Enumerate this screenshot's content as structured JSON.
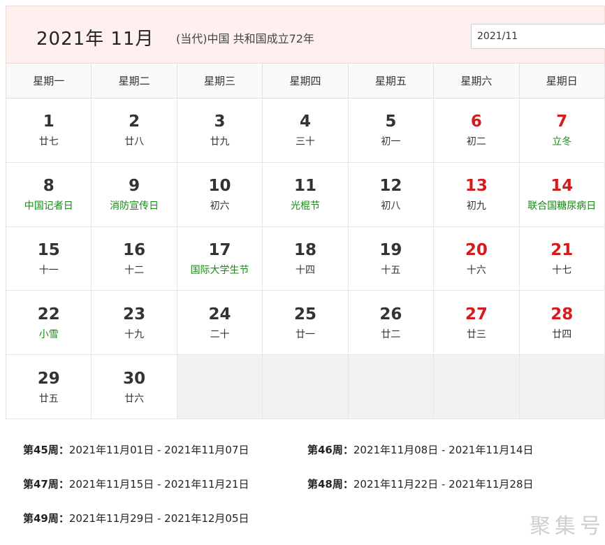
{
  "header": {
    "title": "2021年  11月",
    "era": "(当代)中国 共和国成立72年",
    "date_input_value": "2021/11"
  },
  "weekdays": [
    "星期一",
    "星期二",
    "星期三",
    "星期四",
    "星期五",
    "星期六",
    "星期日"
  ],
  "days": [
    {
      "day": "1",
      "sub": "廿七",
      "red": false,
      "green": false
    },
    {
      "day": "2",
      "sub": "廿八",
      "red": false,
      "green": false
    },
    {
      "day": "3",
      "sub": "廿九",
      "red": false,
      "green": false
    },
    {
      "day": "4",
      "sub": "三十",
      "red": false,
      "green": false
    },
    {
      "day": "5",
      "sub": "初一",
      "red": false,
      "green": false
    },
    {
      "day": "6",
      "sub": "初二",
      "red": true,
      "green": false
    },
    {
      "day": "7",
      "sub": "立冬",
      "red": true,
      "green": true
    },
    {
      "day": "8",
      "sub": "中国记者日",
      "red": false,
      "green": true
    },
    {
      "day": "9",
      "sub": "消防宣传日",
      "red": false,
      "green": true
    },
    {
      "day": "10",
      "sub": "初六",
      "red": false,
      "green": false
    },
    {
      "day": "11",
      "sub": "光棍节",
      "red": false,
      "green": true
    },
    {
      "day": "12",
      "sub": "初八",
      "red": false,
      "green": false
    },
    {
      "day": "13",
      "sub": "初九",
      "red": true,
      "green": false
    },
    {
      "day": "14",
      "sub": "联合国糖尿病日",
      "red": true,
      "green": true
    },
    {
      "day": "15",
      "sub": "十一",
      "red": false,
      "green": false
    },
    {
      "day": "16",
      "sub": "十二",
      "red": false,
      "green": false
    },
    {
      "day": "17",
      "sub": "国际大学生节",
      "red": false,
      "green": true
    },
    {
      "day": "18",
      "sub": "十四",
      "red": false,
      "green": false
    },
    {
      "day": "19",
      "sub": "十五",
      "red": false,
      "green": false
    },
    {
      "day": "20",
      "sub": "十六",
      "red": true,
      "green": false
    },
    {
      "day": "21",
      "sub": "十七",
      "red": true,
      "green": false
    },
    {
      "day": "22",
      "sub": "小雪",
      "red": false,
      "green": true
    },
    {
      "day": "23",
      "sub": "十九",
      "red": false,
      "green": false
    },
    {
      "day": "24",
      "sub": "二十",
      "red": false,
      "green": false
    },
    {
      "day": "25",
      "sub": "廿一",
      "red": false,
      "green": false
    },
    {
      "day": "26",
      "sub": "廿二",
      "red": false,
      "green": false
    },
    {
      "day": "27",
      "sub": "廿三",
      "red": true,
      "green": false
    },
    {
      "day": "28",
      "sub": "廿四",
      "red": true,
      "green": false
    },
    {
      "day": "29",
      "sub": "廿五",
      "red": false,
      "green": false
    },
    {
      "day": "30",
      "sub": "廿六",
      "red": false,
      "green": false
    }
  ],
  "weeks": [
    {
      "label": "第45周：",
      "range": "2021年11月01日 - 2021年11月07日"
    },
    {
      "label": "第46周：",
      "range": "2021年11月08日 - 2021年11月14日"
    },
    {
      "label": "第47周：",
      "range": "2021年11月15日 - 2021年11月21日"
    },
    {
      "label": "第48周：",
      "range": "2021年11月22日 - 2021年11月28日"
    },
    {
      "label": "第49周：",
      "range": "2021年11月29日 - 2021年12月05日"
    }
  ],
  "watermark": "聚集号",
  "colors": {
    "weekend_red": "#d41c1c",
    "festival_green": "#158a15",
    "header_bg": "#fdf0ee",
    "empty_cell": "#f2f2f2"
  }
}
